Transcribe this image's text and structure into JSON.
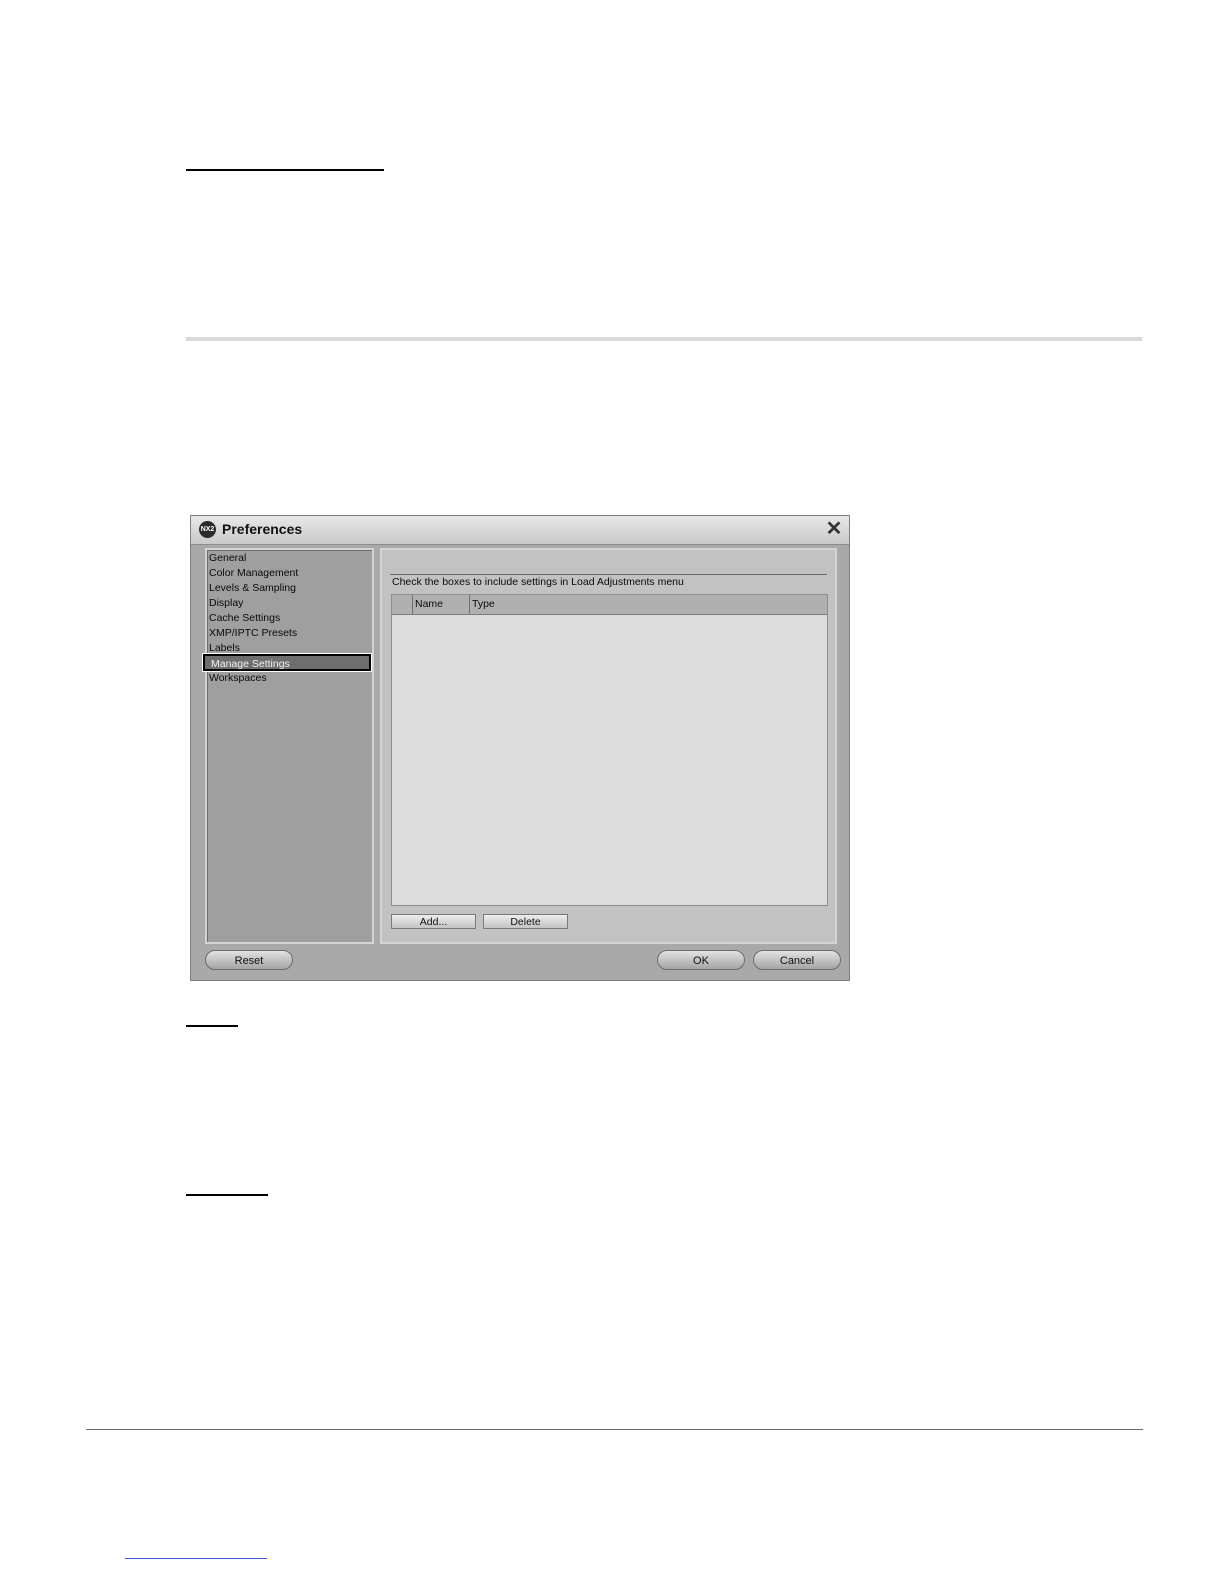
{
  "dialog": {
    "title": "Preferences",
    "app_icon_text": "NX2",
    "close_glyph": "✕",
    "nav_items": [
      {
        "label": "General"
      },
      {
        "label": "Color Management"
      },
      {
        "label": "Levels & Sampling"
      },
      {
        "label": "Display"
      },
      {
        "label": "Cache Settings"
      },
      {
        "label": "XMP/IPTC Presets"
      },
      {
        "label": "Labels"
      },
      {
        "label": "Manage Settings",
        "selected": true
      },
      {
        "label": "Workspaces"
      }
    ],
    "instruction": "Check the boxes to include settings in Load Adjustments menu",
    "table": {
      "columns": [
        "Name",
        "Type"
      ]
    },
    "buttons": {
      "add": "Add...",
      "delete": "Delete",
      "reset": "Reset",
      "ok": "OK",
      "cancel": "Cancel"
    }
  }
}
